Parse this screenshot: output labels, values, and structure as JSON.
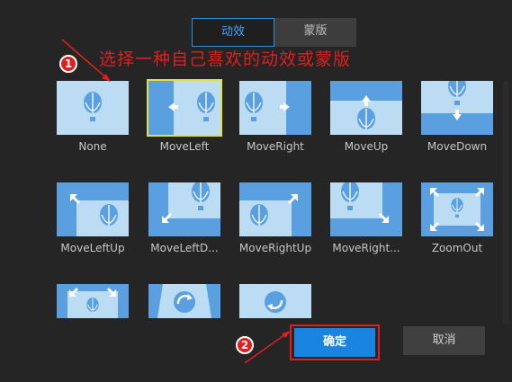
{
  "tabs": [
    {
      "label": "动效",
      "active": true
    },
    {
      "label": "蒙版",
      "active": false
    }
  ],
  "instruction": "选择一种自己喜欢的动效或蒙版",
  "badges": {
    "step1": "1",
    "step2": "2"
  },
  "effects": [
    {
      "label": "None",
      "selected": false
    },
    {
      "label": "MoveLeft",
      "selected": true
    },
    {
      "label": "MoveRight",
      "selected": false
    },
    {
      "label": "MoveUp",
      "selected": false
    },
    {
      "label": "MoveDown",
      "selected": false
    },
    {
      "label": "MoveLeftUp",
      "selected": false
    },
    {
      "label": "MoveLeftD...",
      "selected": false
    },
    {
      "label": "MoveRightUp",
      "selected": false
    },
    {
      "label": "MoveRight...",
      "selected": false
    },
    {
      "label": "ZoomOut",
      "selected": false
    },
    {
      "label": "",
      "selected": false
    },
    {
      "label": "",
      "selected": false
    },
    {
      "label": "",
      "selected": false
    }
  ],
  "buttons": {
    "ok": "确定",
    "cancel": "取消"
  },
  "colors": {
    "accent": "#1a85e0",
    "annotation": "#e01e1e",
    "selection": "#dfe24a",
    "thumb_light": "#bcdcf4",
    "thumb_dark": "#5aa0e0"
  }
}
